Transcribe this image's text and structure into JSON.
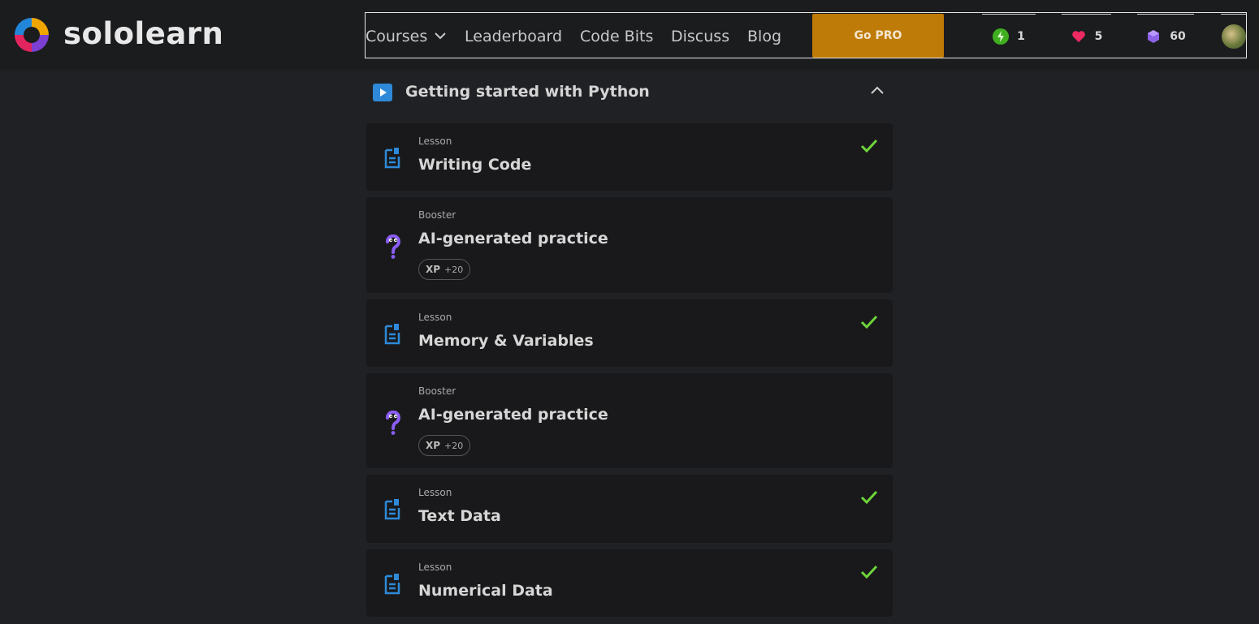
{
  "brand": {
    "name": "sololearn"
  },
  "nav": {
    "links": [
      {
        "label": "Courses",
        "has_dropdown": true
      },
      {
        "label": "Leaderboard"
      },
      {
        "label": "Code Bits"
      },
      {
        "label": "Discuss"
      },
      {
        "label": "Blog"
      }
    ],
    "go_pro": "Go PRO",
    "stats": {
      "streak": {
        "icon": "bolt-icon",
        "value": "1",
        "color": "#3fae1f"
      },
      "hearts": {
        "icon": "heart-icon",
        "value": "5",
        "color": "#ee2a62"
      },
      "gems": {
        "icon": "gem-icon",
        "value": "60",
        "color": "#8e62e6"
      }
    }
  },
  "section": {
    "title": "Getting started with Python",
    "expanded": true
  },
  "items": [
    {
      "kind": "Lesson",
      "title": "Writing Code",
      "completed": true
    },
    {
      "kind": "Booster",
      "title": "AI-generated practice",
      "xp_label": "XP",
      "xp_value": "+20"
    },
    {
      "kind": "Lesson",
      "title": "Memory & Variables",
      "completed": true
    },
    {
      "kind": "Booster",
      "title": "AI-generated practice",
      "xp_label": "XP",
      "xp_value": "+20"
    },
    {
      "kind": "Lesson",
      "title": "Text Data",
      "completed": true
    },
    {
      "kind": "Lesson",
      "title": "Numerical Data",
      "completed": true
    }
  ],
  "colors": {
    "accent_blue": "#2e8ad8",
    "check_green": "#6ed43a",
    "booster_purple": "#8b5cf6",
    "go_pro": "#bf7b07"
  }
}
